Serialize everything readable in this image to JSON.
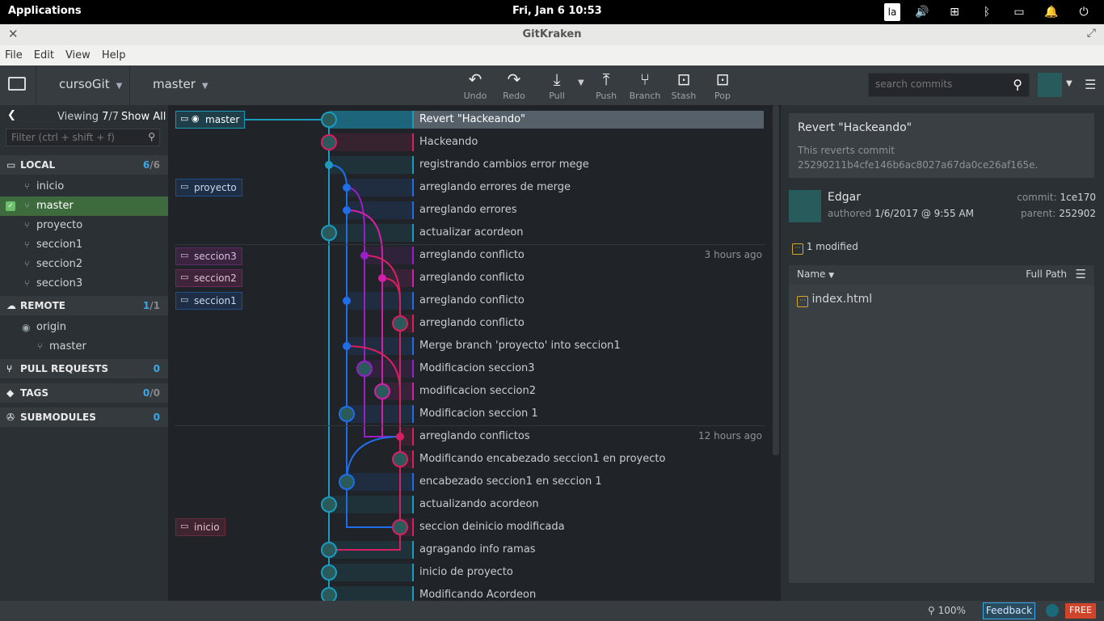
{
  "system": {
    "apps": "Applications",
    "clock": "Fri, Jan  6   10:53",
    "kb": "la"
  },
  "window": {
    "title": "GitKraken"
  },
  "menu": [
    "File",
    "Edit",
    "View",
    "Help"
  ],
  "toolbar": {
    "repo": "cursoGit",
    "branch": "master",
    "undo": "Undo",
    "redo": "Redo",
    "pull": "Pull",
    "push": "Push",
    "branch_btn": "Branch",
    "stash": "Stash",
    "pop": "Pop",
    "search_placeholder": "search commits"
  },
  "sidebar": {
    "viewing": "Viewing",
    "viewing_count": "7",
    "viewing_total": "/7",
    "show_all": "Show All",
    "filter_placeholder": "Filter (ctrl + shift + f)",
    "local": "LOCAL",
    "local_count": "6",
    "local_total": "/6",
    "local_branches": [
      "inicio",
      "master",
      "proyecto",
      "seccion1",
      "seccion2",
      "seccion3"
    ],
    "remote": "REMOTE",
    "remote_count": "1",
    "remote_total": "/1",
    "remote_name": "origin",
    "remote_branch": "master",
    "pull_requests": "PULL REQUESTS",
    "pull_requests_count": "0",
    "tags": "TAGS",
    "tags_count": "0",
    "tags_total": "/0",
    "submodules": "SUBMODULES",
    "submodules_count": "0"
  },
  "graph": {
    "commits": [
      {
        "msg": "Revert \"Hackeando\"",
        "time": ""
      },
      {
        "msg": "Hackeando",
        "time": ""
      },
      {
        "msg": "registrando cambios error mege",
        "time": ""
      },
      {
        "msg": "arreglando errores de merge",
        "time": ""
      },
      {
        "msg": "arreglando errores",
        "time": ""
      },
      {
        "msg": "actualizar acordeon",
        "time": ""
      },
      {
        "msg": "arreglando conflicto",
        "time": "3 hours ago"
      },
      {
        "msg": "arreglando conflicto",
        "time": ""
      },
      {
        "msg": "arreglando conflicto",
        "time": ""
      },
      {
        "msg": "arreglando conflicto",
        "time": ""
      },
      {
        "msg": "Merge branch 'proyecto' into seccion1",
        "time": ""
      },
      {
        "msg": "Modificacion seccion3",
        "time": ""
      },
      {
        "msg": "modificacion seccion2",
        "time": ""
      },
      {
        "msg": "Modificacion seccion 1",
        "time": ""
      },
      {
        "msg": "arreglando conflictos",
        "time": "12 hours ago"
      },
      {
        "msg": "Modificando encabezado seccion1 en proyecto",
        "time": ""
      },
      {
        "msg": "encabezado seccion1 en seccion 1",
        "time": ""
      },
      {
        "msg": "actualizando acordeon",
        "time": ""
      },
      {
        "msg": "seccion deinicio modificada",
        "time": ""
      },
      {
        "msg": "agragando info ramas",
        "time": ""
      },
      {
        "msg": "inicio de proyecto",
        "time": ""
      },
      {
        "msg": "Modificando Acordeon",
        "time": ""
      }
    ],
    "labels": [
      "master",
      "proyecto",
      "seccion3",
      "seccion2",
      "seccion1",
      "inicio"
    ]
  },
  "detail": {
    "title": "Revert \"Hackeando\"",
    "desc": "This reverts commit 25290211b4cfe146b6ac8027a67da0ce26af165e.",
    "author": "Edgar",
    "authored": "authored",
    "date": "1/6/2017 @ 9:55 AM",
    "commit_label": "commit:",
    "commit": "1ce170",
    "parent_label": "parent:",
    "parent": "252902",
    "modified": "1 modified",
    "name_col": "Name",
    "full_path": "Full Path",
    "file": "index.html"
  },
  "status": {
    "zoom": "100%",
    "feedback": "Feedback",
    "free": "FREE"
  },
  "colors": {
    "teal": "#1c9bbf",
    "blue": "#1f6ee8",
    "purple": "#9a1fc8",
    "magenta": "#d41fa8",
    "pink": "#d81f62",
    "accent": "#3ba8e8"
  }
}
